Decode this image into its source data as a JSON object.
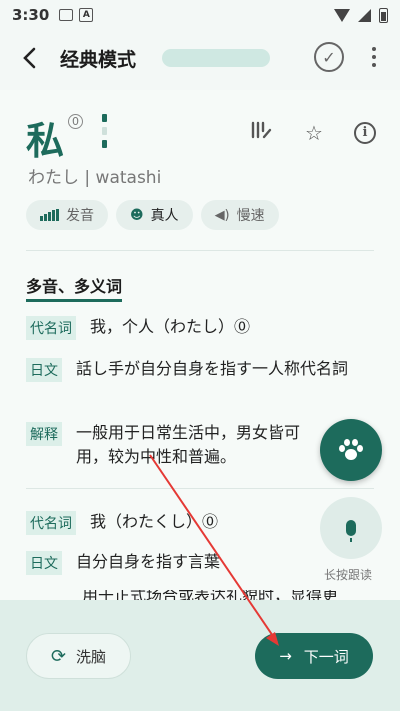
{
  "status_bar": {
    "time": "3:30"
  },
  "app_bar": {
    "title": "经典模式"
  },
  "word": {
    "kanji": "私",
    "tone": "0",
    "reading": "わたし | watashi"
  },
  "audio": {
    "pronounce": "发音",
    "real_voice": "真人",
    "slow": "慢速"
  },
  "section": {
    "title": "多音、多义词"
  },
  "entries": [
    {
      "tag": "代名词",
      "text": "我，个人（わたし）⓪"
    },
    {
      "tag": "日文",
      "text": "話し手が自分自身を指す一人称代名詞"
    },
    {
      "tag": "解释",
      "text": "一般用于日常生活中，男女皆可用，较为中性和普遍。"
    },
    {
      "tag": "代名词",
      "text": "我（わたくし）⓪"
    },
    {
      "tag": "日文",
      "text": "自分自身を指す言葉"
    },
    {
      "text": "用于正式场合或表达礼貌时，显得更"
    }
  ],
  "mic": {
    "hint": "长按跟读"
  },
  "bottom": {
    "brain_label": "洗脑",
    "next_label": "下一词"
  },
  "colors": {
    "accent": "#1d6b5c",
    "annotation": "#e53935"
  }
}
